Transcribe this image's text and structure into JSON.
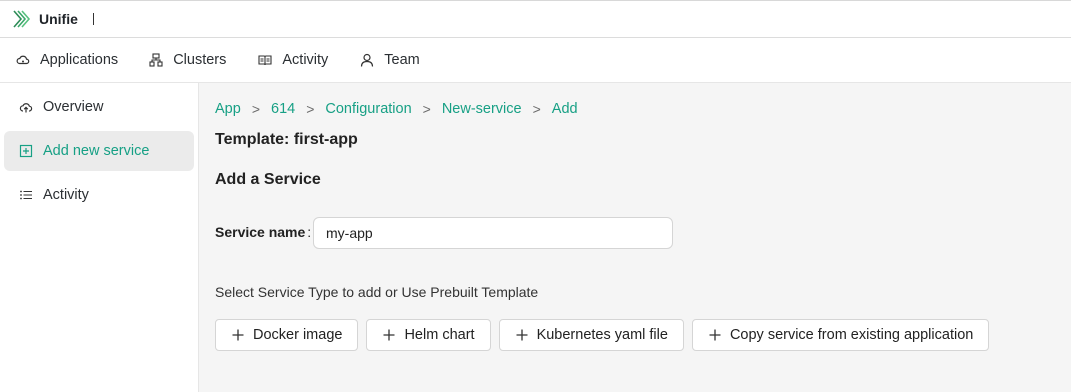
{
  "app": {
    "name": "Unifie"
  },
  "nav": {
    "items": [
      {
        "label": "Applications",
        "icon": "cloud-icon"
      },
      {
        "label": "Clusters",
        "icon": "cluster-icon"
      },
      {
        "label": "Activity",
        "icon": "book-icon"
      },
      {
        "label": "Team",
        "icon": "user-icon"
      }
    ]
  },
  "sidebar": {
    "items": [
      {
        "label": "Overview",
        "icon": "cloud-upload-icon"
      },
      {
        "label": "Add new service",
        "icon": "plus-square-icon",
        "active": true
      },
      {
        "label": "Activity",
        "icon": "list-icon"
      }
    ]
  },
  "breadcrumb": [
    {
      "label": "App"
    },
    {
      "label": "614"
    },
    {
      "label": "Configuration"
    },
    {
      "label": "New-service"
    },
    {
      "label": "Add"
    }
  ],
  "main": {
    "template_title": "Template: first-app",
    "section_title": "Add a Service",
    "service_name_label": "Service name",
    "service_name_colon": ":",
    "service_name_value": "my-app",
    "hint": "Select Service Type to add or Use Prebuilt Template",
    "buttons": [
      {
        "label": "Docker image"
      },
      {
        "label": "Helm chart"
      },
      {
        "label": "Kubernetes yaml file"
      },
      {
        "label": "Copy service from existing application"
      }
    ]
  },
  "colors": {
    "accent": "#17a085",
    "active_bg": "#ebebeb",
    "page_bg": "#f5f5f5"
  }
}
